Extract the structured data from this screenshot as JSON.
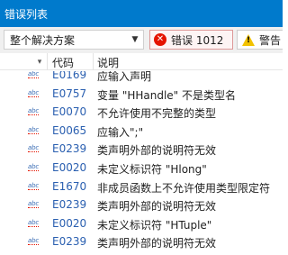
{
  "window": {
    "title": "错误列表"
  },
  "toolbar": {
    "scope_value": "整个解决方案",
    "errors_label": "错误 1012",
    "warnings_label": "警告"
  },
  "columns": {
    "code": "代码",
    "description": "说明"
  },
  "rows": [
    {
      "type": "abc",
      "code": "E0169",
      "description": "应输入声明"
    },
    {
      "type": "abc",
      "code": "E0757",
      "description": "变量 \"HHandle\" 不是类型名"
    },
    {
      "type": "abc",
      "code": "E0070",
      "description": "不允许使用不完整的类型"
    },
    {
      "type": "abc",
      "code": "E0065",
      "description": "应输入\";\""
    },
    {
      "type": "abc",
      "code": "E0239",
      "description": "类声明外部的说明符无效"
    },
    {
      "type": "abc",
      "code": "E0020",
      "description": "未定义标识符 \"Hlong\""
    },
    {
      "type": "abc",
      "code": "E1670",
      "description": "非成员函数上不允许使用类型限定符"
    },
    {
      "type": "abc",
      "code": "E0239",
      "description": "类声明外部的说明符无效"
    },
    {
      "type": "abc",
      "code": "E0020",
      "description": "未定义标识符 \"HTuple\""
    },
    {
      "type": "abc",
      "code": "E0239",
      "description": "类声明外部的说明符无效"
    }
  ]
}
